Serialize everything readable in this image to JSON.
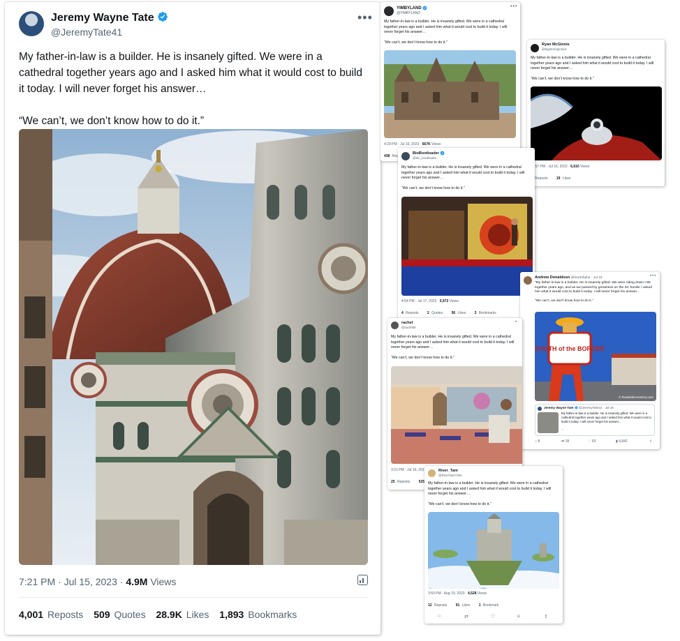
{
  "main": {
    "name": "Jeremy Wayne Tate",
    "handle": "@JeremyTate41",
    "text": "My father-in-law is a builder. He is insanely gifted. We were in a cathedral together years ago and I asked him what it would cost to build it today. I will never forget his answer…\n\n“We can’t, we don’t know how to do it.”",
    "time": "7:21 PM · Jul 15, 2023 · ",
    "views_value": "4.9M",
    "views_label": " Views",
    "reposts_value": "4,001",
    "reposts_label": "Reposts",
    "quotes_value": "509",
    "quotes_label": "Quotes",
    "likes_value": "28.9K",
    "likes_label": "Likes",
    "bookmarks_value": "1,893",
    "bookmarks_label": "Bookmarks"
  },
  "yimby": {
    "name": "YIMBYLAND",
    "handle": "@YIMBYLAND",
    "text": "My father-in-law is a builder. He is insanely gifted. We were in a cathedral together years ago and I asked him what it would cost to build it today. I will never forget his answer…\n\n“We can’t, we don’t know how to do it.”",
    "time": "4:29 PM · Jul 16, 2023 · ",
    "views_value": "667K",
    "views_label": " Views",
    "reposts_value": "438",
    "reposts_label": "Rep"
  },
  "ryan": {
    "name": "Ryan McGinnis",
    "handle": "@bigstormpicture",
    "text": "My father-in-law is a builder. He is insanely gifted. We were in a cathedral together years ago and I asked him what it would cost to build it today. I will never forget his answer…\n\n“We can’t, we don’t know how to do it.”",
    "time": "11:57 PM · Jul 16, 2023 · ",
    "views_value": "6,610",
    "views_label": " Views",
    "reposts_value": "2",
    "reposts_label": "Reposts",
    "likes_value": "19",
    "likes_label": "Likes"
  },
  "bio": {
    "name": "BioBootloader",
    "handle": "@bio_bootloader",
    "text": "My father-in-law is a builder. He is insanely gifted. We were in a cathedral together years ago and I asked him what it would cost to build it today. I will never forget his answer…\n\n“We can’t, we don’t know how to do it.”",
    "time": "4:54 PM · Jul 17, 2023 · ",
    "views_value": "5,972",
    "views_label": " Views",
    "reposts_value": "4",
    "reposts_label": "Reposts",
    "quotes_value": "2",
    "quotes_label": "Quotes",
    "likes_value": "56",
    "likes_label": "Likes",
    "bookmarks_value": "3",
    "bookmarks_label": "Bookmarks"
  },
  "andrew": {
    "name": "Andrew Donaldson",
    "handle": "@fourthfathe · Jul 16",
    "text": "“My father-in-law is a builder. He is insanely gifted. We were riding down I-95 together years ago, and as we passed by greatness on the SC border I asked him what it would cost to build it today. I will never forget his answer...\n\n“We can’t, we don’t know how to do it.”",
    "image_caption": "© RoadsideAmerica.com",
    "sign_text": "SOUTH of the BORDER",
    "quoted_name": "Jeremy Wayne Tate",
    "quoted_handle": "@JeremyTate41 · Jul 15",
    "quoted_text": "My father-in-law is a builder. He is insanely gifted. We were in a cathedral together years ago and I asked him what it would cost to build it today. I will never forget his answer...",
    "quoted_more": "...",
    "replies": "8",
    "reposts": "18",
    "likes": "63",
    "views": "4,842"
  },
  "rachel": {
    "name": "rachel",
    "handle": "@rachfsfe",
    "text": "My father-in-law is a builder. He is insanely gifted. We were in a cathedral together years ago and I asked him what it would cost to build it today. I will never forget his answer…\n\n“We can’t, we don’t know how to do it.”",
    "time": "3:21 PM · Jul 16, 202",
    "reposts_value": "25",
    "reposts_label": "Reposts",
    "likes_value": "525",
    "likes_label": "L"
  },
  "river": {
    "name": "River_Tam",
    "handle": "@RiverTamYON",
    "text": "My father-in-law is a builder. He is insanely gifted. We were in a cathedral together years ago and I asked him what it would cost to build it today. I will never forget his answer…\n\n“We can’t, we don’t know how to do it.”",
    "time": "3:50 PM · Aug 19, 2023 · ",
    "views_value": "4,528",
    "views_label": " Views",
    "reposts_value": "12",
    "reposts_label": "Reposts",
    "likes_value": "91",
    "likes_label": "Likes",
    "bookmarks_value": "1",
    "bookmarks_label": "Bookmark"
  },
  "colors": {
    "verified": "#1d9bf0",
    "text": "#0f1419",
    "muted": "#536471"
  }
}
